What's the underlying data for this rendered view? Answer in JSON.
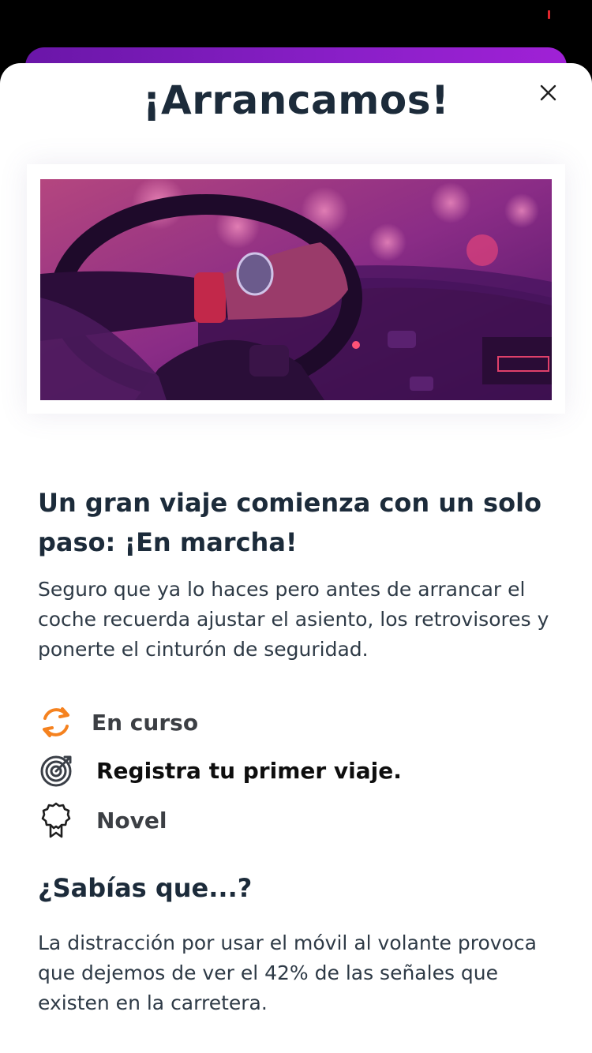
{
  "modal": {
    "title": "¡Arrancamos!"
  },
  "content": {
    "headline": "Un gran viaje comienza con un solo paso: ¡En marcha!",
    "description": "Seguro que ya lo haces pero antes de arrancar el coche recuerda ajustar el asiento, los retrovisores y ponerte el cinturón de seguridad."
  },
  "status_rows": {
    "status": {
      "icon": "refresh-icon",
      "label": "En curso"
    },
    "goal": {
      "icon": "target-icon",
      "label": "Registra tu primer viaje."
    },
    "level": {
      "icon": "award-ribbon-icon",
      "label": "Novel"
    }
  },
  "fact": {
    "title": "¿Sabías que...?",
    "text": "La distracción por usar el móvil al volante provoca que dejemos de ver el 42% de las señales que existen en la carretera."
  },
  "colors": {
    "brand_purple": "#8a1fc8",
    "status_orange": "#f5821f",
    "text_dark": "#1c2b3a"
  }
}
